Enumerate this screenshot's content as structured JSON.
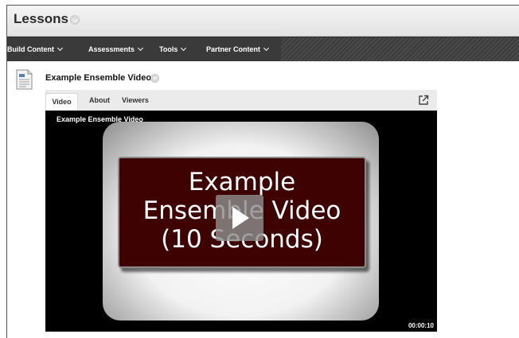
{
  "header": {
    "title": "Lessons"
  },
  "menubar": {
    "items": [
      {
        "label": "Build Content"
      },
      {
        "label": "Assessments"
      },
      {
        "label": "Tools"
      },
      {
        "label": "Partner Content"
      }
    ]
  },
  "content_item": {
    "title": "Example Ensemble Video",
    "icon": "document-icon"
  },
  "player": {
    "tabs": [
      {
        "label": "Video",
        "active": true
      },
      {
        "label": "About",
        "active": false
      },
      {
        "label": "Viewers",
        "active": false
      }
    ],
    "external_link_icon": "external-link-icon",
    "overlay_title": "Example Ensemble Video",
    "slide_lines": [
      "Example",
      "Ensemble Video",
      "(10 Seconds)"
    ],
    "duration": "00:00:10"
  },
  "colors": {
    "menubar": "#3a3a3a",
    "slide_box": "#3e0202",
    "video_bg": "#000000"
  }
}
